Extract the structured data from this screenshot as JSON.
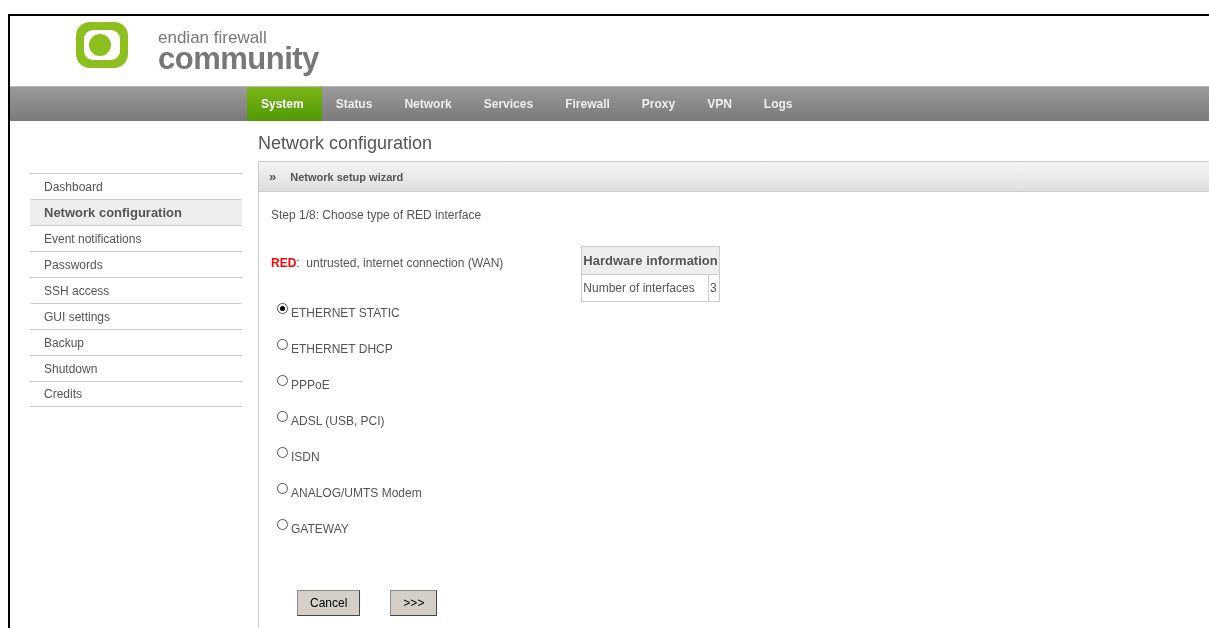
{
  "logo": {
    "line1": "endian firewall",
    "line2": "community"
  },
  "nav": [
    {
      "label": "System",
      "selected": true
    },
    {
      "label": "Status",
      "selected": false
    },
    {
      "label": "Network",
      "selected": false
    },
    {
      "label": "Services",
      "selected": false
    },
    {
      "label": "Firewall",
      "selected": false
    },
    {
      "label": "Proxy",
      "selected": false
    },
    {
      "label": "VPN",
      "selected": false
    },
    {
      "label": "Logs",
      "selected": false
    }
  ],
  "page_title": "Network configuration",
  "sidebar": {
    "items": [
      {
        "label": "Dashboard",
        "selected": false
      },
      {
        "label": "Network configuration",
        "selected": true
      },
      {
        "label": "Event notifications",
        "selected": false
      },
      {
        "label": "Passwords",
        "selected": false
      },
      {
        "label": "SSH access",
        "selected": false
      },
      {
        "label": "GUI settings",
        "selected": false
      },
      {
        "label": "Backup",
        "selected": false
      },
      {
        "label": "Shutdown",
        "selected": false
      },
      {
        "label": "Credits",
        "selected": false
      }
    ]
  },
  "panel": {
    "toggle": "»",
    "title": "Network setup wizard",
    "step": "Step 1/8: Choose type of RED interface",
    "zone": {
      "label": "RED",
      "color": "#ff0000",
      "description": ":  untrusted, internet connection (WAN)"
    },
    "options": [
      {
        "label": "ETHERNET STATIC",
        "selected": true
      },
      {
        "label": "ETHERNET DHCP",
        "selected": false
      },
      {
        "label": "PPPoE",
        "selected": false
      },
      {
        "label": "ADSL (USB, PCI)",
        "selected": false
      },
      {
        "label": "ISDN",
        "selected": false
      },
      {
        "label": "ANALOG/UMTS Modem",
        "selected": false
      },
      {
        "label": "GATEWAY",
        "selected": false
      }
    ],
    "hardware": {
      "title": "Hardware information",
      "rows": [
        {
          "label": "Number of interfaces",
          "value": "3"
        }
      ]
    },
    "buttons": [
      "Cancel",
      ">>>"
    ]
  }
}
